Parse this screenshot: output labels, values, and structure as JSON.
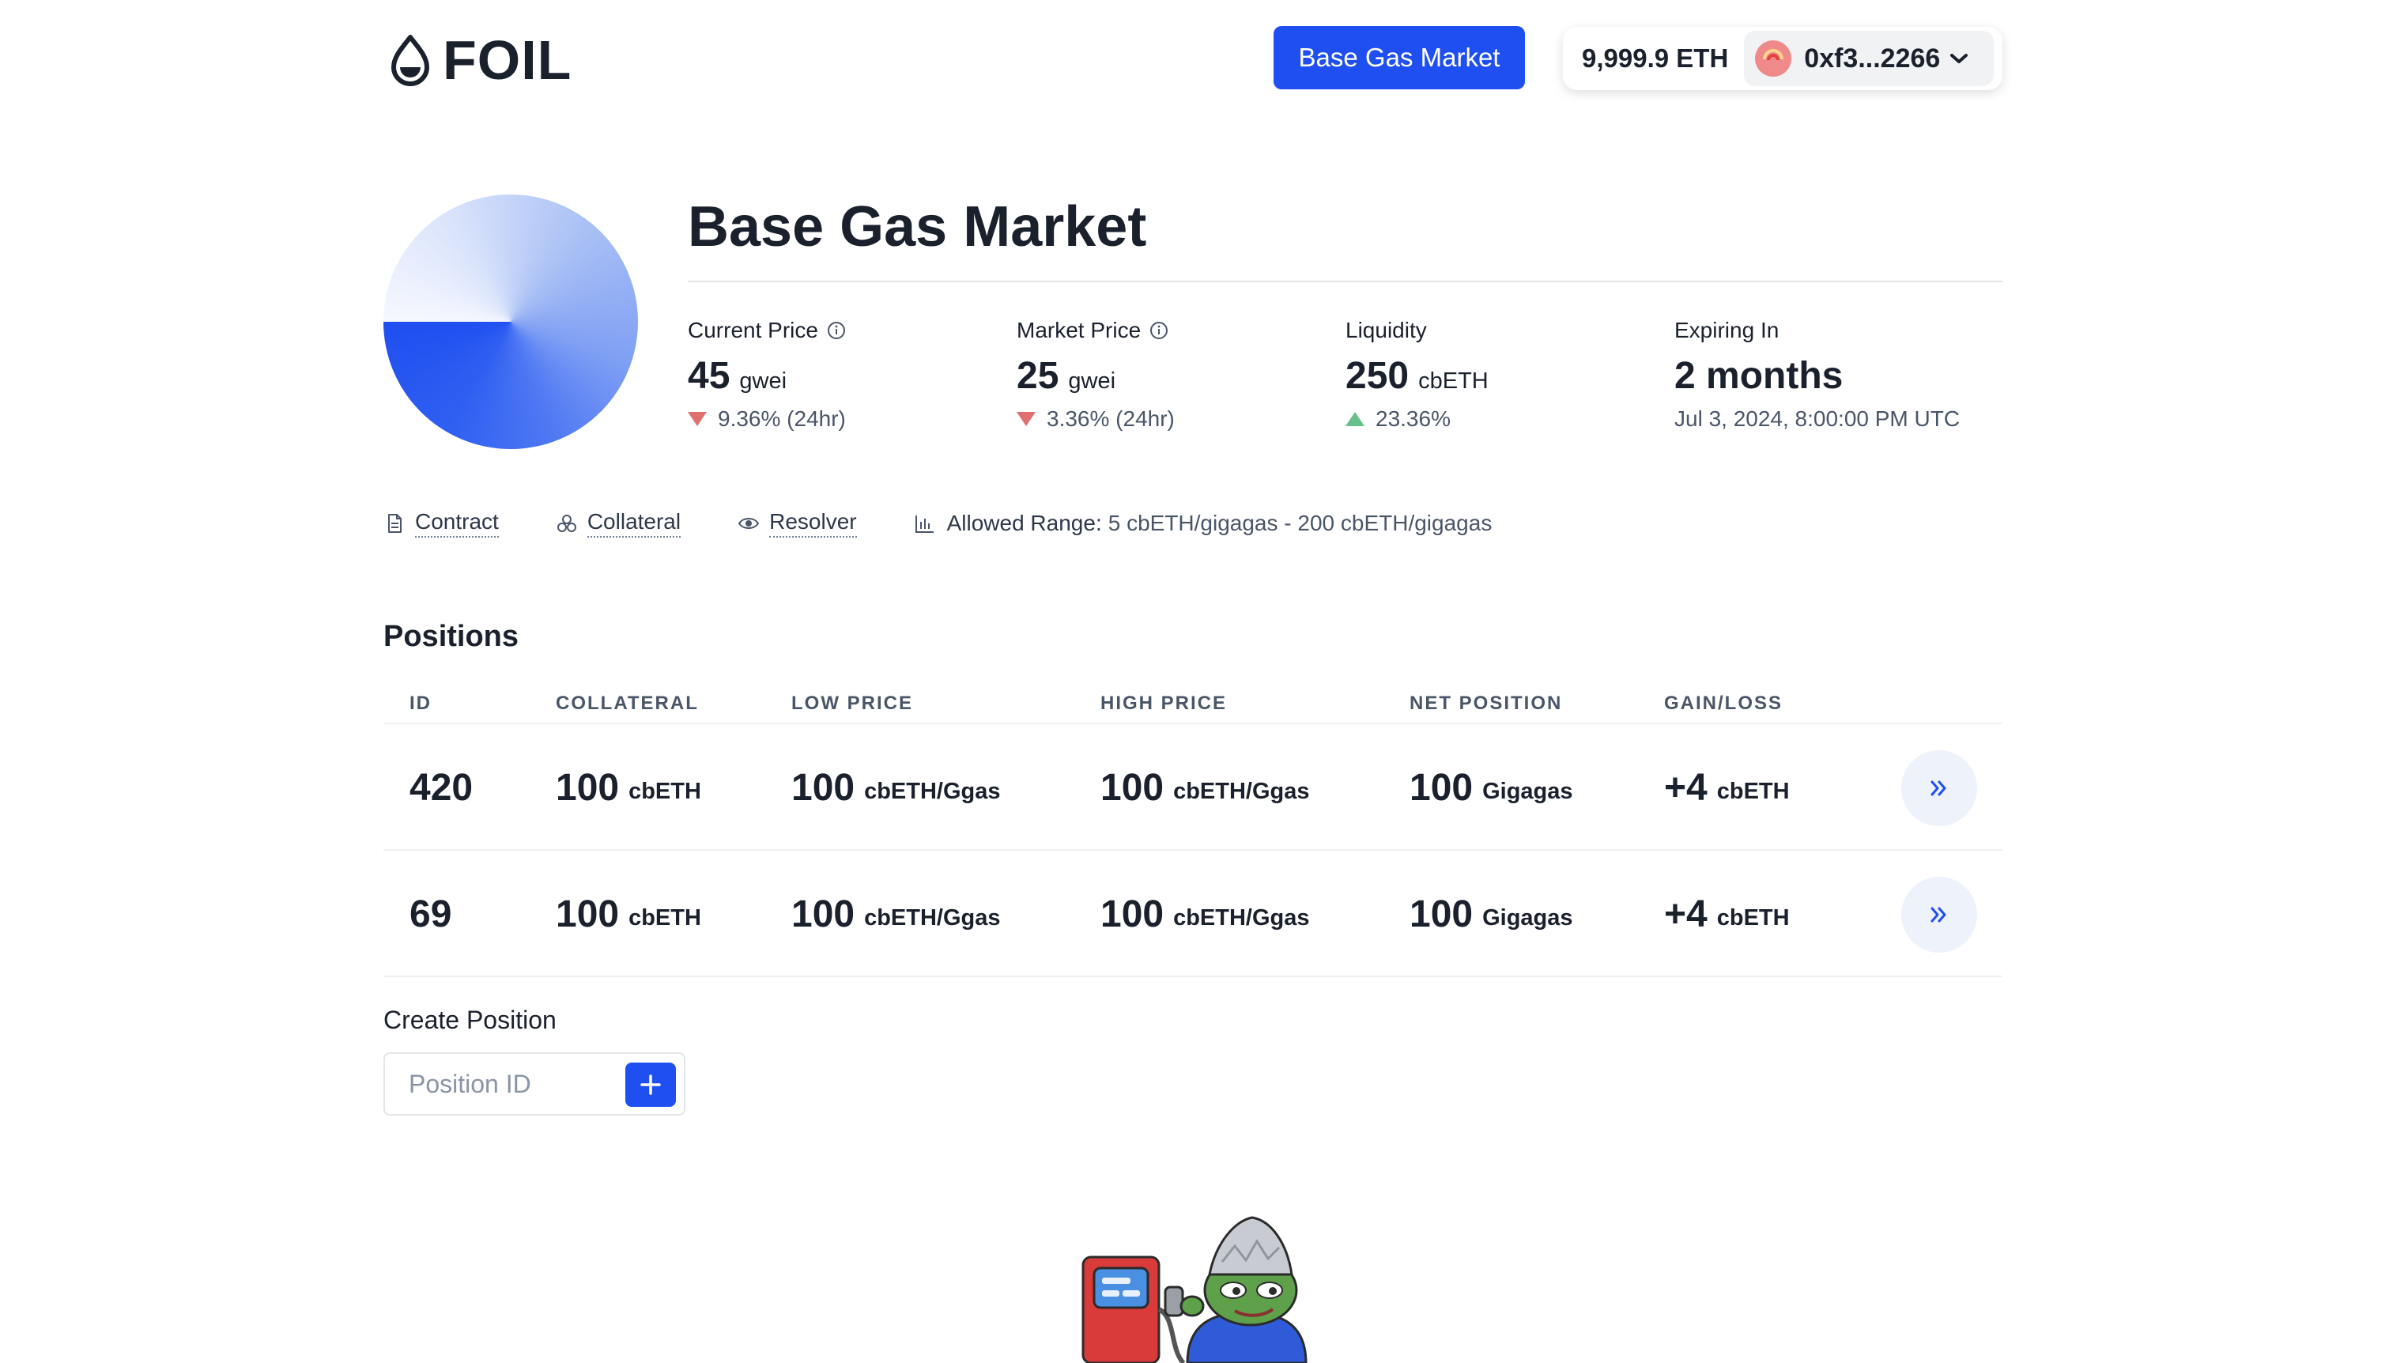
{
  "header": {
    "logo_text": "FOIL",
    "market_button": "Base Gas Market",
    "wallet": {
      "balance": "9,999.9 ETH",
      "address": "0xf3...2266"
    }
  },
  "market": {
    "title": "Base Gas Market",
    "stats": [
      {
        "label": "Current Price",
        "value": "45",
        "unit": "gwei",
        "change": "9.36% (24hr)",
        "direction": "down"
      },
      {
        "label": "Market Price",
        "value": "25",
        "unit": "gwei",
        "change": "3.36% (24hr)",
        "direction": "down"
      },
      {
        "label": "Liquidity",
        "value": "250",
        "unit": "cbETH",
        "change": "23.36%",
        "direction": "up"
      },
      {
        "label": "Expiring In",
        "value": "2 months",
        "unit": "",
        "change": "Jul 3, 2024, 8:00:00 PM UTC",
        "direction": "none"
      }
    ],
    "links": {
      "contract": "Contract",
      "collateral": "Collateral",
      "resolver": "Resolver",
      "range_label": "Allowed Range:",
      "range_value": "5 cbETH/gigagas - 200 cbETH/gigagas"
    }
  },
  "positions": {
    "title": "Positions",
    "columns": [
      "ID",
      "COLLATERAL",
      "LOW PRICE",
      "HIGH PRICE",
      "NET POSITION",
      "GAIN/LOSS"
    ],
    "rows": [
      {
        "id": "420",
        "collateral": "100",
        "collateral_unit": "cbETH",
        "low": "100",
        "low_unit": "cbETH/Ggas",
        "high": "100",
        "high_unit": "cbETH/Ggas",
        "net": "100",
        "net_unit": "Gigagas",
        "gain": "+4",
        "gain_unit": "cbETH"
      },
      {
        "id": "69",
        "collateral": "100",
        "collateral_unit": "cbETH",
        "low": "100",
        "low_unit": "cbETH/Ggas",
        "high": "100",
        "high_unit": "cbETH/Ggas",
        "net": "100",
        "net_unit": "Gigagas",
        "gain": "+4",
        "gain_unit": "cbETH"
      }
    ]
  },
  "create_position": {
    "label": "Create Position",
    "input_value": "",
    "input_placeholder": "Position ID"
  },
  "colors": {
    "accent": "#1f4ff0",
    "down": "#e07070",
    "up": "#68c08a"
  },
  "icons": [
    "drop-logo-icon",
    "info-icon",
    "document-icon",
    "coins-icon",
    "eye-icon",
    "bar-chart-icon",
    "chevron-down-icon",
    "double-chevron-right-icon",
    "plus-icon"
  ]
}
